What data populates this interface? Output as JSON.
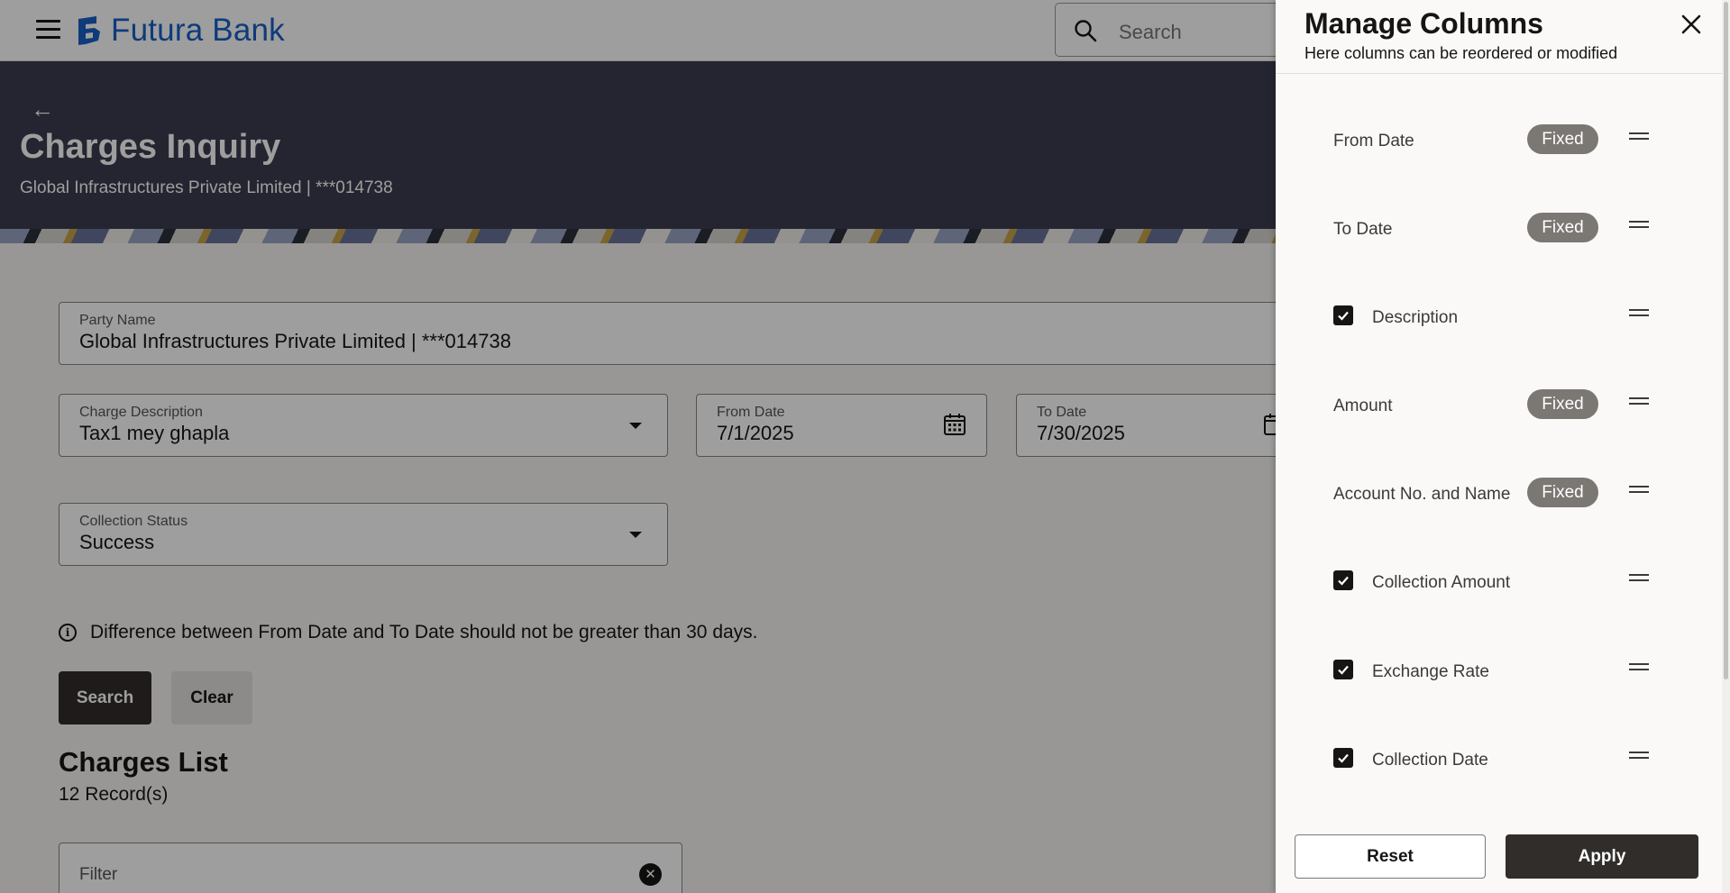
{
  "header": {
    "brand": "Futura Bank",
    "search_placeholder": "Search"
  },
  "hero": {
    "back": "←",
    "title": "Charges Inquiry",
    "subtitle": "Global Infrastructures Private Limited | ***014738"
  },
  "form": {
    "party_name": {
      "label": "Party Name",
      "value": "Global Infrastructures  Private Limited | ***014738"
    },
    "charge_description": {
      "label": "Charge Description",
      "value": "Tax1 mey ghapla"
    },
    "from_date": {
      "label": "From Date",
      "value": "7/1/2025"
    },
    "to_date": {
      "label": "To Date",
      "value": "7/30/2025"
    },
    "collection_status": {
      "label": "Collection Status",
      "value": "Success"
    },
    "info": "Difference between From Date and To Date should not be greater than 30 days.",
    "search_button": "Search",
    "clear_button": "Clear"
  },
  "charges_list": {
    "title": "Charges List",
    "count": "12 Record(s)",
    "filter_placeholder": "Filter"
  },
  "drawer": {
    "title": "Manage Columns",
    "subtitle": "Here columns can be reordered or modified",
    "fixed_label": "Fixed",
    "columns": [
      {
        "label": "From Date",
        "fixed": true
      },
      {
        "label": "To Date",
        "fixed": true
      },
      {
        "label": "Description",
        "fixed": false,
        "checked": true
      },
      {
        "label": "Amount",
        "fixed": true
      },
      {
        "label": "Account No. and Name",
        "fixed": true
      },
      {
        "label": "Collection Amount",
        "fixed": false,
        "checked": true
      },
      {
        "label": "Exchange Rate",
        "fixed": false,
        "checked": true
      },
      {
        "label": "Collection Date",
        "fixed": false,
        "checked": true
      }
    ],
    "reset_button": "Reset",
    "apply_button": "Apply"
  },
  "colors": {
    "brand": "#1760c5",
    "hero_bg": "#3a3c4e",
    "primary_button": "#312d2a",
    "fixed_badge": "#7b7773"
  }
}
